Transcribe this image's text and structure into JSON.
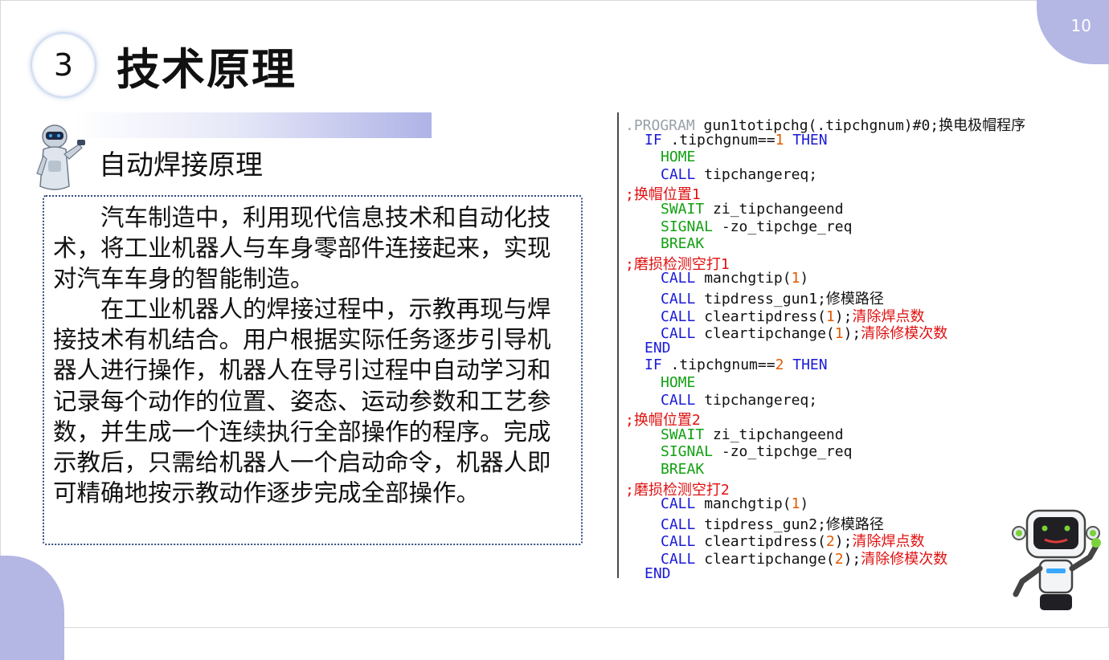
{
  "page": {
    "number": "10"
  },
  "section": {
    "number": "3",
    "title": "技术原理"
  },
  "subsection": {
    "title": "自动焊接原理"
  },
  "body": {
    "paragraph1": "汽车制造中，利用现代信息技术和自动化技术，将工业机器人与车身零部件连接起来，实现对汽车车身的智能制造。",
    "paragraph2": "在工业机器人的焊接过程中，示教再现与焊接技术有机结合。用户根据实际任务逐步引导机器人进行操作，机器人在导引过程中自动学习和记录每个动作的位置、姿态、运动参数和工艺参数，并生成一个连续执行全部操作的程序。完成示教后，只需给机器人一个启动命令，机器人即可精确地按示教动作逐步完成全部操作。"
  },
  "code": {
    "lines": [
      {
        "indent": 0,
        "parts": [
          {
            "t": ".PROGRAM",
            "c": "pgm"
          },
          {
            "t": " gun1totipchg(.tipchgnum)#0;换电极帽程序",
            "c": "txt"
          }
        ]
      },
      {
        "indent": 1,
        "parts": [
          {
            "t": "IF",
            "c": "kw"
          },
          {
            "t": " .tipchgnum==",
            "c": "txt"
          },
          {
            "t": "1",
            "c": "num"
          },
          {
            "t": " THEN",
            "c": "kw"
          }
        ]
      },
      {
        "indent": 2,
        "parts": [
          {
            "t": "HOME",
            "c": "kwg"
          }
        ]
      },
      {
        "indent": 2,
        "parts": [
          {
            "t": "CALL",
            "c": "kw"
          },
          {
            "t": " tipchangereq;",
            "c": "txt"
          }
        ]
      },
      {
        "indent": 0,
        "parts": [
          {
            "t": ";换帽位置1",
            "c": "cmt"
          }
        ]
      },
      {
        "indent": 2,
        "parts": [
          {
            "t": "SWAIT",
            "c": "kwg"
          },
          {
            "t": " zi_tipchangeend",
            "c": "txt"
          }
        ]
      },
      {
        "indent": 2,
        "parts": [
          {
            "t": "SIGNAL",
            "c": "kwg"
          },
          {
            "t": " -zo_tipchge_req",
            "c": "txt"
          }
        ]
      },
      {
        "indent": 2,
        "parts": [
          {
            "t": "BREAK",
            "c": "kwg"
          }
        ]
      },
      {
        "indent": 0,
        "parts": [
          {
            "t": ";磨损检测空打1",
            "c": "cmt"
          }
        ]
      },
      {
        "indent": 2,
        "parts": [
          {
            "t": "CALL",
            "c": "kw"
          },
          {
            "t": " manchgtip(",
            "c": "txt"
          },
          {
            "t": "1",
            "c": "num"
          },
          {
            "t": ")",
            "c": "txt"
          }
        ]
      },
      {
        "indent": 2,
        "parts": [
          {
            "t": "CALL",
            "c": "kw"
          },
          {
            "t": " tipdress_gun1;修模路径",
            "c": "txt"
          }
        ]
      },
      {
        "indent": 2,
        "parts": [
          {
            "t": "CALL",
            "c": "kw"
          },
          {
            "t": " cleartipdress(",
            "c": "txt"
          },
          {
            "t": "1",
            "c": "num"
          },
          {
            "t": ");",
            "c": "txt"
          },
          {
            "t": "清除焊点数",
            "c": "cmt"
          }
        ]
      },
      {
        "indent": 2,
        "parts": [
          {
            "t": "CALL",
            "c": "kw"
          },
          {
            "t": " cleartipchange(",
            "c": "txt"
          },
          {
            "t": "1",
            "c": "num"
          },
          {
            "t": ");",
            "c": "txt"
          },
          {
            "t": "清除修模次数",
            "c": "cmt"
          }
        ]
      },
      {
        "indent": 1,
        "parts": [
          {
            "t": "END",
            "c": "kw"
          }
        ]
      },
      {
        "indent": 1,
        "parts": [
          {
            "t": "IF",
            "c": "kw"
          },
          {
            "t": " .tipchgnum==",
            "c": "txt"
          },
          {
            "t": "2",
            "c": "num"
          },
          {
            "t": " THEN",
            "c": "kw"
          }
        ]
      },
      {
        "indent": 2,
        "parts": [
          {
            "t": "HOME",
            "c": "kwg"
          }
        ]
      },
      {
        "indent": 2,
        "parts": [
          {
            "t": "CALL",
            "c": "kw"
          },
          {
            "t": " tipchangereq;",
            "c": "txt"
          }
        ]
      },
      {
        "indent": 0,
        "parts": [
          {
            "t": ";换帽位置2",
            "c": "cmt"
          }
        ]
      },
      {
        "indent": 2,
        "parts": [
          {
            "t": "SWAIT",
            "c": "kwg"
          },
          {
            "t": " zi_tipchangeend",
            "c": "txt"
          }
        ]
      },
      {
        "indent": 2,
        "parts": [
          {
            "t": "SIGNAL",
            "c": "kwg"
          },
          {
            "t": " -zo_tipchge_req",
            "c": "txt"
          }
        ]
      },
      {
        "indent": 2,
        "parts": [
          {
            "t": "BREAK",
            "c": "kwg"
          }
        ]
      },
      {
        "indent": 0,
        "parts": [
          {
            "t": ";磨损检测空打2",
            "c": "cmt"
          }
        ]
      },
      {
        "indent": 2,
        "parts": [
          {
            "t": "CALL",
            "c": "kw"
          },
          {
            "t": " manchgtip(",
            "c": "txt"
          },
          {
            "t": "1",
            "c": "num"
          },
          {
            "t": ")",
            "c": "txt"
          }
        ]
      },
      {
        "indent": 2,
        "parts": [
          {
            "t": "CALL",
            "c": "kw"
          },
          {
            "t": " tipdress_gun2;修模路径",
            "c": "txt"
          }
        ]
      },
      {
        "indent": 2,
        "parts": [
          {
            "t": "CALL",
            "c": "kw"
          },
          {
            "t": " cleartipdress(",
            "c": "txt"
          },
          {
            "t": "2",
            "c": "num"
          },
          {
            "t": ");",
            "c": "txt"
          },
          {
            "t": "清除焊点数",
            "c": "cmt"
          }
        ]
      },
      {
        "indent": 2,
        "parts": [
          {
            "t": "CALL",
            "c": "kw"
          },
          {
            "t": " cleartipchange(",
            "c": "txt"
          },
          {
            "t": "2",
            "c": "num"
          },
          {
            "t": ");",
            "c": "txt"
          },
          {
            "t": "清除修模次数",
            "c": "cmt"
          }
        ]
      },
      {
        "indent": 1,
        "parts": [
          {
            "t": "END",
            "c": "kw"
          }
        ]
      }
    ]
  },
  "decor": {
    "accent_color": "#b4b6e4",
    "icons": [
      "robot-mascot-icon",
      "robot-head-icon"
    ]
  }
}
